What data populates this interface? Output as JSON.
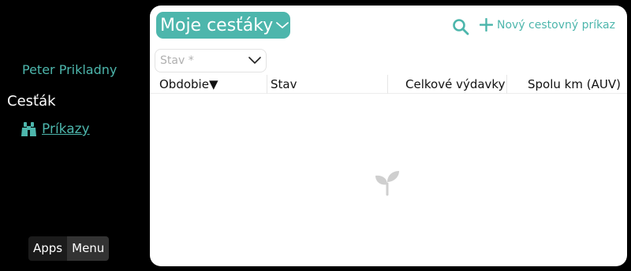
{
  "sidebar": {
    "user_name": "Peter Prikladny",
    "section_title": "Cesťák",
    "nav_items": [
      {
        "label": "Príkazy",
        "icon": "binoculars-icon"
      }
    ],
    "bottom_tabs": [
      {
        "label": "Apps"
      },
      {
        "label": "Menu",
        "active": true
      }
    ]
  },
  "header": {
    "title": "Moje cesťáky",
    "search_icon": "search-icon",
    "new_button_label": "Nový cestovný príkaz"
  },
  "filter": {
    "placeholder": "Stav *"
  },
  "table": {
    "columns": [
      {
        "label": "Obdobie▼"
      },
      {
        "label": "Stav"
      },
      {
        "label": "Celkové výdavky"
      },
      {
        "label": "Spolu km (AUV)"
      }
    ],
    "rows": []
  },
  "empty_state": {
    "icon": "sprout-icon"
  },
  "colors": {
    "accent": "#4db6ac",
    "background": "#000000",
    "panel": "#ffffff"
  }
}
